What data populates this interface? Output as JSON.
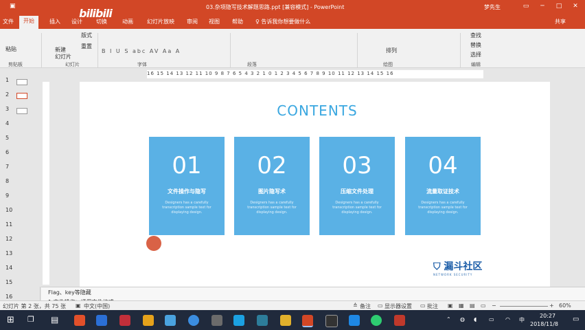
{
  "window": {
    "title": "03.杂项隐写技术解题思路.ppt [兼容模式] - PowerPoint",
    "user": "梦先生",
    "share": "共享"
  },
  "overlay_watermark": "bilibili",
  "tabs": [
    "开始",
    "插入",
    "设计",
    "切换",
    "动画",
    "幻灯片放映",
    "审阅",
    "视图",
    "帮助",
    "♀ 告诉我你想要做什么"
  ],
  "ribbon": {
    "paste": "粘贴",
    "new_slide": "新建\n幻灯片",
    "layout": "版式",
    "reset": "重置",
    "font_styles": "B I U S abc AV Aa A",
    "arrange": "排列",
    "find": "查找",
    "replace": "替换",
    "select": "选择",
    "groups": [
      "剪贴板",
      "幻灯片",
      "字体",
      "段落",
      "绘图",
      "编辑"
    ]
  },
  "ruler": {
    "numbers": "16 15 14 13 12 11 10 9 8 7 6 5 4 3 2 1 0 1 2 3 4 5 6 7 8 9 10 11 12 13 14 15 16"
  },
  "slide_numbers": [
    "1",
    "2",
    "3",
    "4",
    "5",
    "6",
    "7",
    "8",
    "9",
    "10",
    "11",
    "12",
    "13",
    "14",
    "15",
    "16"
  ],
  "slide": {
    "title": "CONTENTS",
    "cards": [
      {
        "num": "01",
        "label": "文件操作与隐写",
        "desc": "Designers has a carefully transcription sample text for displaying design."
      },
      {
        "num": "02",
        "label": "图片隐写术",
        "desc": "Designers has a carefully transcription sample text for displaying design."
      },
      {
        "num": "03",
        "label": "压缩文件处理",
        "desc": "Designers has a carefully transcription sample text for displaying design."
      },
      {
        "num": "04",
        "label": "流量取证技术",
        "desc": "Designers has a carefully transcription sample text for displaying design."
      }
    ],
    "logo_text": "漏斗社区",
    "logo_sub": "NETWORK SECURITY"
  },
  "notes": {
    "line1": "Flag、key等隐藏",
    "line2": "1.文件操作：通用文件格式"
  },
  "status": {
    "slide_info": "幻灯片 第 2 张，共 75 张",
    "language": "中文(中国)",
    "notes_btn": "备注",
    "display_settings": "显示器设置",
    "comments": "批注",
    "zoom": "60%"
  },
  "taskbar": {
    "ime": "中",
    "time": "20:27",
    "date": "2018/11/8"
  },
  "colors": {
    "accent": "#d24726",
    "card": "#5ab1e5",
    "title": "#3aa7e0",
    "taskbar": "#202a3c"
  }
}
